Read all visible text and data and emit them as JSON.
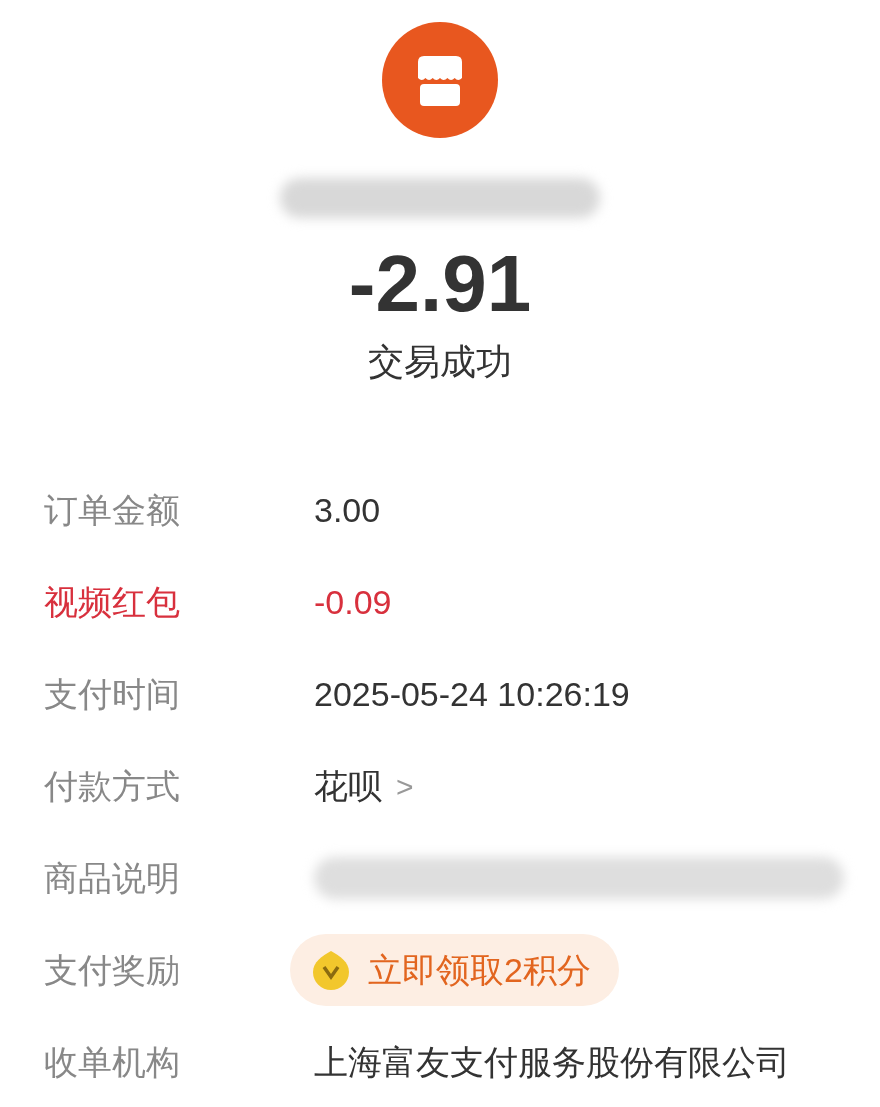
{
  "merchant": {
    "name_redacted": true
  },
  "amount": "-2.91",
  "status": "交易成功",
  "details": [
    {
      "kind": "text",
      "label": "订单金额",
      "value": "3.00"
    },
    {
      "kind": "deduction",
      "label": "视频红包",
      "value": "-0.09"
    },
    {
      "kind": "text",
      "label": "支付时间",
      "value": "2025-05-24 10:26:19"
    },
    {
      "kind": "link",
      "label": "付款方式",
      "value": "花呗",
      "chevron": ">"
    },
    {
      "kind": "redacted",
      "label": "商品说明"
    },
    {
      "kind": "reward",
      "label": "支付奖励",
      "value": "立即领取2积分"
    },
    {
      "kind": "text",
      "label": "收单机构",
      "value": "上海富友支付服务股份有限公司"
    }
  ]
}
